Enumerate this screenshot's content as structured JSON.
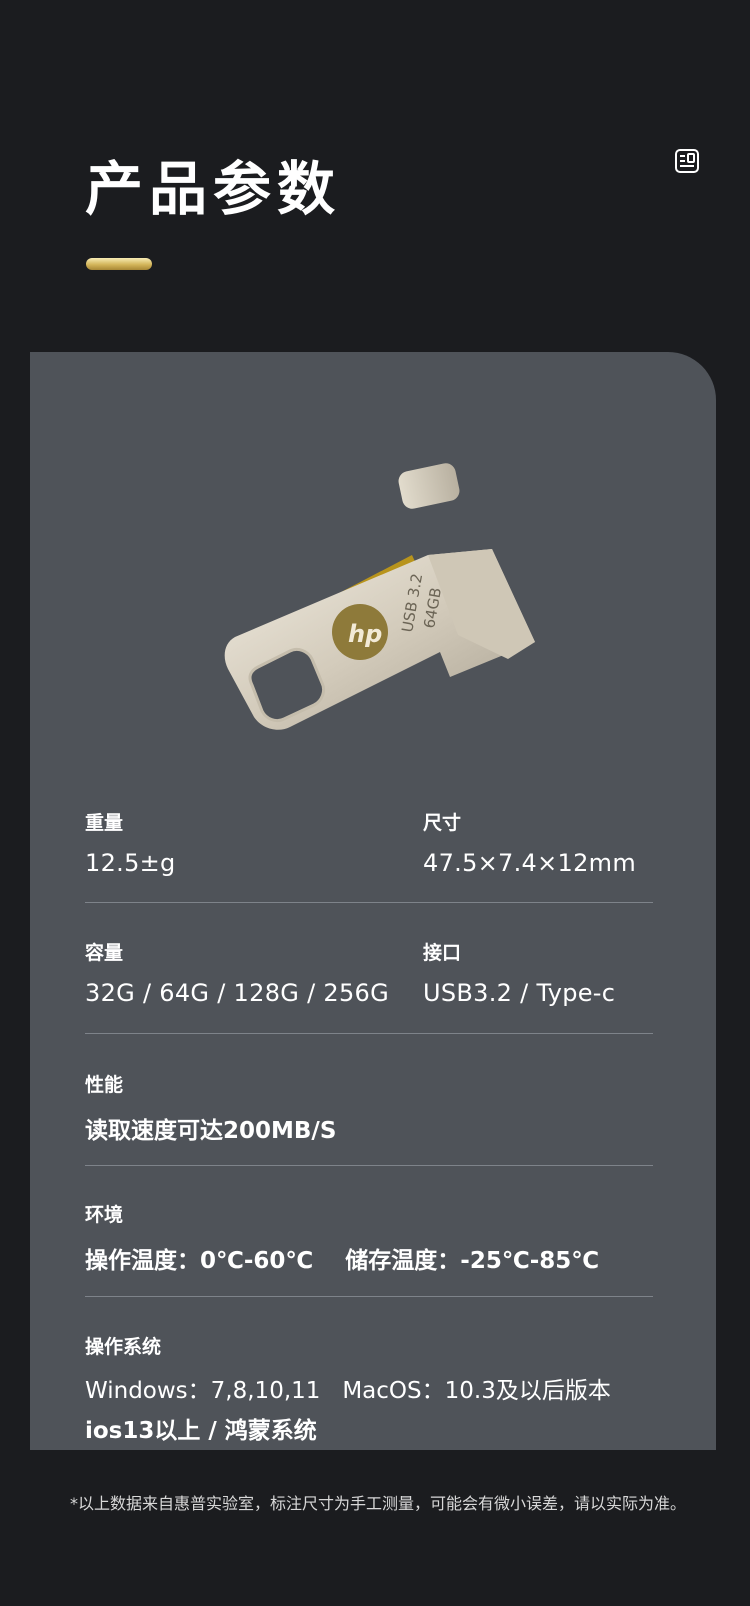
{
  "header": {
    "title": "产品参数"
  },
  "icons": {
    "corner": "spec-sheet-icon",
    "product": "hp-usb-drive-image"
  },
  "colors": {
    "background": "#1b1c1f",
    "card": "#4f5359",
    "accent_gold": "#d3b55a",
    "divider": "#7e838a"
  },
  "product": {
    "engraving_line1": "USB 3.2",
    "engraving_line2": "64GB",
    "logo_text": "hp"
  },
  "specs": {
    "weight": {
      "label": "重量",
      "value": "12.5±g"
    },
    "size": {
      "label": "尺寸",
      "value": "47.5×7.4×12mm"
    },
    "capacity": {
      "label": "容量",
      "value": "32G / 64G / 128G / 256G"
    },
    "interface": {
      "label": "接口",
      "value": "USB3.2 / Type-c"
    },
    "performance": {
      "label": "性能",
      "value": "读取速度可达200MB/S"
    },
    "environment": {
      "label": "环境",
      "value": "操作温度：0℃-60℃    储存温度：-25℃-85℃"
    },
    "os": {
      "label": "操作系统",
      "line1": "Windows：7,8,10,11   MacOS：10.3及以后版本",
      "line2": "ios13以上 / 鸿蒙系统"
    }
  },
  "footer": {
    "note": "*以上数据来自惠普实验室，标注尺寸为手工测量，可能会有微小误差，请以实际为准。"
  }
}
